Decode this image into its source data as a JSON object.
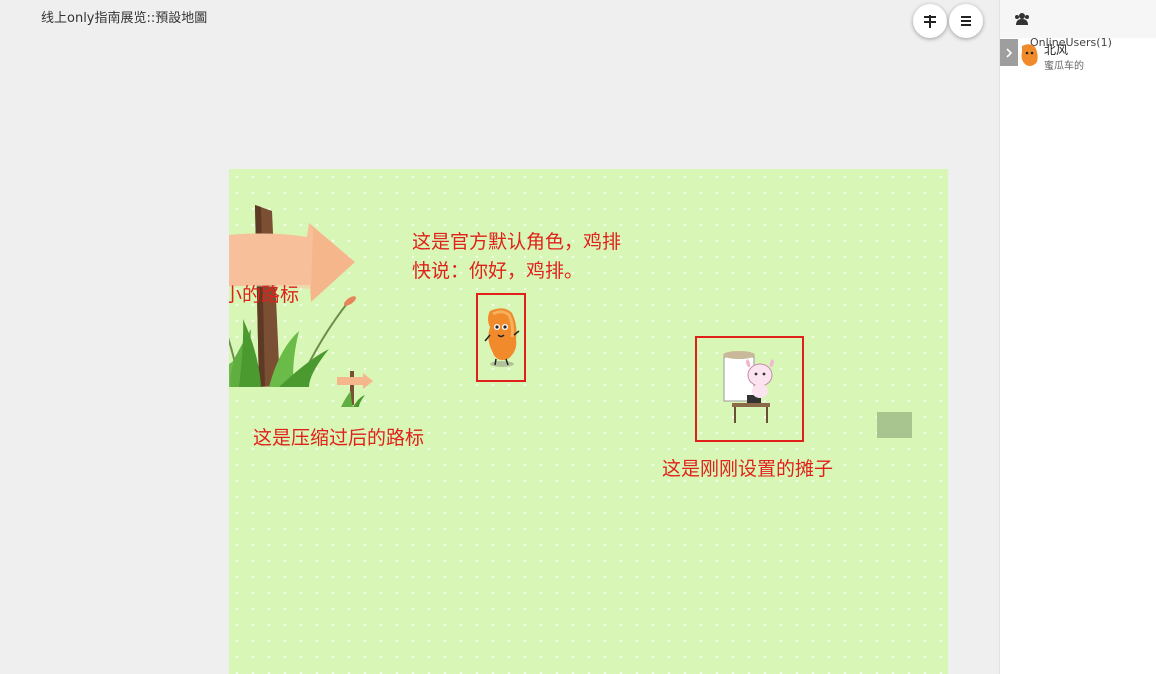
{
  "window": {
    "title": "线上only指南展览::預設地圖"
  },
  "toolbar": {
    "filter_icon": "filter-icon",
    "menu_icon": "menu-icon"
  },
  "map": {
    "notes": {
      "original_sign": "这是原大小的路标",
      "compressed_sign": "这是压缩过后的路标",
      "default_role_line1": "这是官方默认角色，鸡排",
      "default_role_line2": "快说：你好，鸡排。",
      "stall": "这是刚刚设置的摊子"
    },
    "colors": {
      "ground": "#d8f7b6",
      "annotation": "#e0211b"
    }
  },
  "sidebar": {
    "title": "OnlineUsers(1)",
    "users": [
      {
        "name": "北风",
        "subtitle": "蜜瓜车的"
      }
    ]
  }
}
